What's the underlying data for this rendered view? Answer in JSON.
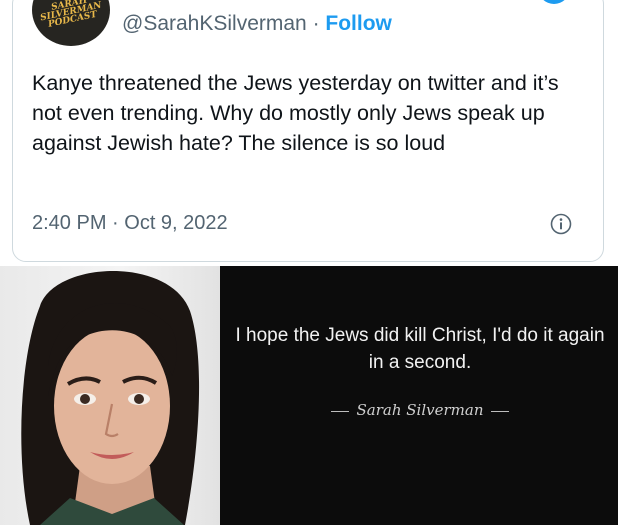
{
  "tweet": {
    "avatar_text": "SARAH SILVERMAN PODCAST",
    "handle": "@SarahKSilverman",
    "separator": " · ",
    "follow_label": "Follow",
    "text": "Kanye threatened the Jews yesterday on twitter and it’s not even trending.  Why do mostly only Jews speak up against Jewish hate? The silence is so loud",
    "timestamp": "2:40 PM · Oct 9, 2022",
    "info_icon": "info-circle-icon",
    "accent_color": "#1d9bf0"
  },
  "quote_image": {
    "quote": "I hope the Jews did kill Christ, I'd do it again in a second.",
    "attribution": "Sarah Silverman"
  }
}
